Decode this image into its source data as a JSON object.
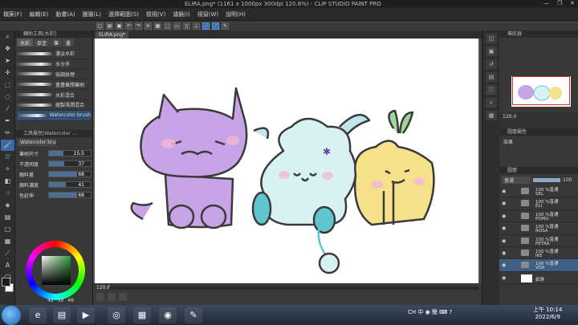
{
  "window": {
    "title": "ELIRA.png* (1161 x 1000px 300dpi 120.8%)  - CLIP STUDIO PAINT PRO",
    "controls": [
      "—",
      "❐",
      "✕"
    ]
  },
  "menu": [
    "檔案(F)",
    "編輯(E)",
    "動畫(A)",
    "圖層(L)",
    "選擇範圍(S)",
    "檢視(V)",
    "濾鏡(I)",
    "視窗(W)",
    "說明(H)"
  ],
  "canvas": {
    "tab_label": "ELIRA.png*",
    "zoom": "120.8"
  },
  "subtool_panel": {
    "header": "輔助工具[水彩]",
    "tabs": [
      "水彩",
      "厚塗",
      "筆",
      "墨"
    ],
    "brushes": [
      {
        "name": "濃淡水彩",
        "selected": false
      },
      {
        "name": "水分多",
        "selected": false
      },
      {
        "name": "強調紋理",
        "selected": false
      },
      {
        "name": "重疊暈開筆刷",
        "selected": false
      },
      {
        "name": "水彩混合",
        "selected": false
      },
      {
        "name": "繪製濕潤混合",
        "selected": false
      },
      {
        "name": "Watercolor brush",
        "selected": true
      }
    ]
  },
  "tool_property": {
    "header": "工具屬性[Watercolor ...",
    "brush_name": "Watercolor brush",
    "props": [
      {
        "label": "筆刷尺寸",
        "value": "15.5",
        "level": 0.35
      },
      {
        "label": "不透明度",
        "value": "37",
        "level": 0.37
      },
      {
        "label": "顏料量",
        "value": "68",
        "level": 0.68
      },
      {
        "label": "顏料濃度",
        "value": "41",
        "level": 0.41
      },
      {
        "label": "色延伸",
        "value": "68",
        "level": 0.68
      }
    ]
  },
  "color_panel": {
    "values": [
      "42",
      "50",
      "46"
    ]
  },
  "navigator": {
    "header": "導航器",
    "zoom": "120.0"
  },
  "layer_property": {
    "header": "圖層屬性",
    "effect_label": "效果"
  },
  "layers_panel": {
    "header": "圖層",
    "blend_mode": "普通",
    "opacity": "100",
    "layers": [
      {
        "mode": "100 %普通",
        "name": "SEL",
        "selected": false
      },
      {
        "mode": "100 %普通",
        "name": "ELI",
        "selected": false
      },
      {
        "mode": "100 %普通",
        "name": "POMU",
        "selected": false
      },
      {
        "mode": "100 %普通",
        "name": "ROSA",
        "selected": false
      },
      {
        "mode": "100 %普通",
        "name": "PETRA",
        "selected": false
      },
      {
        "mode": "100 %普通",
        "name": "IKE",
        "selected": false
      },
      {
        "mode": "100 %普通",
        "name": "VOX",
        "selected": true
      },
      {
        "mode": "",
        "name": "紙張",
        "selected": false
      }
    ]
  },
  "taskbar": {
    "tray_text": "CH  中 ◉ 簡 ⌨ ?",
    "time": "上午 10:14",
    "date": "2022/6/9"
  }
}
